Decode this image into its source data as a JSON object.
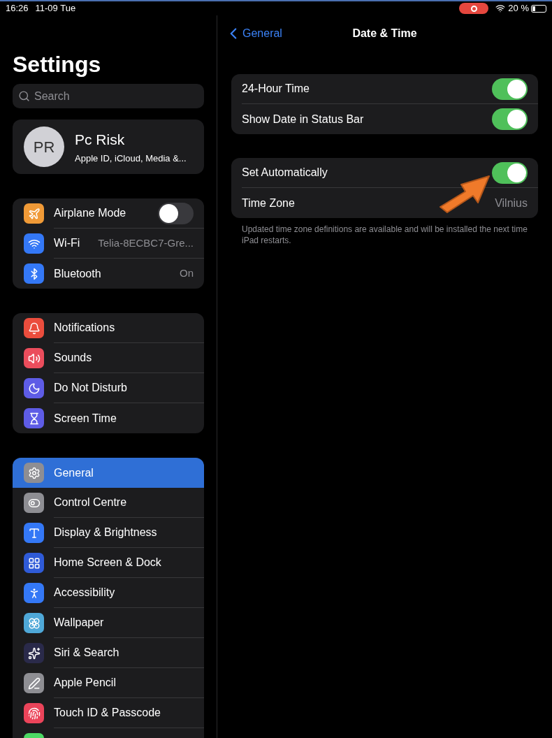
{
  "status_bar": {
    "time": "16:26",
    "date": "11-09 Tue",
    "recording": true,
    "battery": "20 %"
  },
  "sidebar": {
    "title": "Settings",
    "search": {
      "placeholder": "Search"
    },
    "profile": {
      "initials": "PR",
      "name": "Pc Risk",
      "subtitle": "Apple ID, iCloud, Media &..."
    },
    "groups": [
      [
        {
          "label": "Airplane Mode",
          "kind": "toggle",
          "on": false,
          "color": "#f09a37",
          "selected": false
        },
        {
          "label": "Wi-Fi",
          "kind": "value",
          "value": "Telia-8ECBC7-Gre...",
          "color": "#3478f6",
          "selected": false
        },
        {
          "label": "Bluetooth",
          "kind": "value",
          "value": "On",
          "color": "#3478f6",
          "selected": false
        }
      ],
      [
        {
          "label": "Notifications",
          "kind": "link",
          "color": "#eb4d3d",
          "selected": false
        },
        {
          "label": "Sounds",
          "kind": "link",
          "color": "#eb4d5c",
          "selected": false
        },
        {
          "label": "Do Not Disturb",
          "kind": "link",
          "color": "#5e5ce6",
          "selected": false
        },
        {
          "label": "Screen Time",
          "kind": "link",
          "color": "#5e5ce6",
          "selected": false
        }
      ],
      [
        {
          "label": "General",
          "kind": "link",
          "color": "#8e8e93",
          "selected": true
        },
        {
          "label": "Control Centre",
          "kind": "link",
          "color": "#8e8e93",
          "selected": false
        },
        {
          "label": "Display & Brightness",
          "kind": "link",
          "color": "#3478f6",
          "selected": false
        },
        {
          "label": "Home Screen & Dock",
          "kind": "link",
          "color": "#2f5bd8",
          "selected": false
        },
        {
          "label": "Accessibility",
          "kind": "link",
          "color": "#3478f6",
          "selected": false
        },
        {
          "label": "Wallpaper",
          "kind": "link",
          "color": "#4fa8d8",
          "selected": false
        },
        {
          "label": "Siri & Search",
          "kind": "link",
          "color": "#2a2a4a",
          "selected": false
        },
        {
          "label": "Apple Pencil",
          "kind": "link",
          "color": "#8e8e93",
          "selected": false
        },
        {
          "label": "Touch ID & Passcode",
          "kind": "link",
          "color": "#eb445a",
          "selected": false
        },
        {
          "kind": "link",
          "color": "#4cd964",
          "selected": false
        }
      ]
    ]
  },
  "detail": {
    "back": "General",
    "title": "Date & Time",
    "groups": [
      [
        {
          "label": "24-Hour Time",
          "kind": "toggle",
          "on": true
        },
        {
          "label": "Show Date in Status Bar",
          "kind": "toggle",
          "on": true
        }
      ],
      [
        {
          "label": "Set Automatically",
          "kind": "toggle",
          "on": true
        },
        {
          "label": "Time Zone",
          "kind": "value",
          "value": "Vilnius"
        }
      ]
    ],
    "footnote": "Updated time zone definitions are available and will be installed the next time iPad restarts."
  }
}
